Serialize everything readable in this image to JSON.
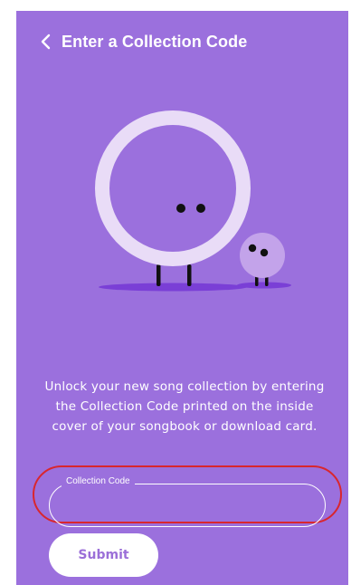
{
  "header": {
    "back_icon": "chevron-left-icon",
    "title": "Enter a Collection Code"
  },
  "illustration": {
    "description_icon": "mascot-illustration"
  },
  "main": {
    "description": "Unlock your new song collection by entering the Collection Code printed on the inside cover of your songbook or download card."
  },
  "form": {
    "code_label": "Collection Code",
    "code_value": "",
    "submit_label": "Submit"
  },
  "colors": {
    "background": "#9b70dd",
    "ring_light": "#e9dcf7",
    "shadow": "#7a3fd6",
    "highlight": "#d9262e"
  }
}
